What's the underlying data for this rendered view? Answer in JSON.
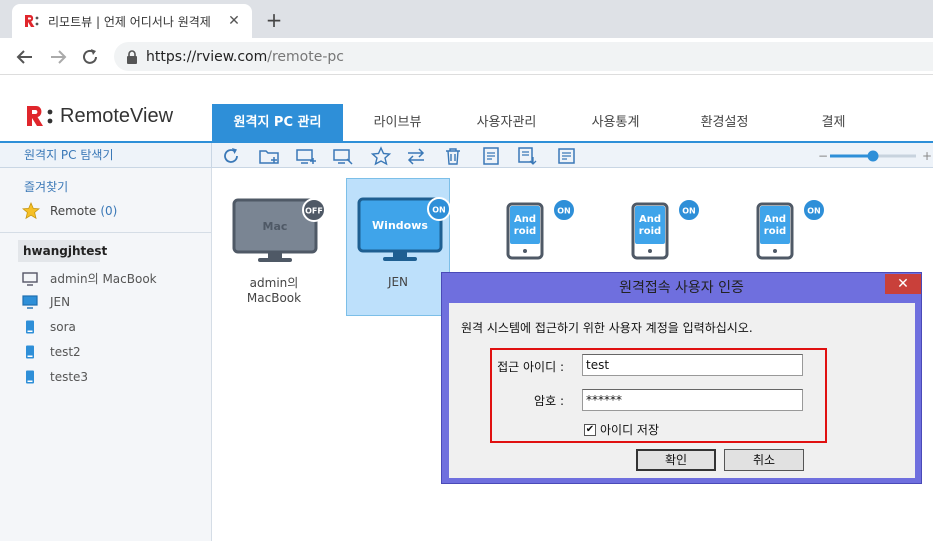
{
  "browser": {
    "tab_title": "리모트뷰 | 언제 어디서나 원격제",
    "tab_close": "✕",
    "new_tab": "+",
    "url_host": "https://rview.com",
    "url_path": "/remote-pc"
  },
  "app": {
    "brand": "RemoteView",
    "nav": [
      "원격지 PC 관리",
      "라이브뷰",
      "사용자관리",
      "사용통계",
      "환경설정",
      "결제"
    ],
    "explorer_title": "원격지 PC 탐색기",
    "zoom_minus": "−",
    "zoom_plus": "+",
    "zoom_level": 0.5
  },
  "sidebar": {
    "favorites_title": "즐겨찾기",
    "favorite_item": "Remote",
    "favorite_count": "(0)",
    "group": "hwangjhtest",
    "pcs": [
      {
        "label": "admin의 MacBook",
        "icon": "monitor-icon"
      },
      {
        "label": "JEN",
        "icon": "monitor-icon"
      },
      {
        "label": "sora",
        "icon": "tablet-icon"
      },
      {
        "label": "test2",
        "icon": "tablet-icon"
      },
      {
        "label": "teste3",
        "icon": "tablet-icon"
      }
    ]
  },
  "devices": [
    {
      "os": "Mac",
      "label1": "admin의",
      "label2": "MacBook",
      "status": "OFF"
    },
    {
      "os": "Windows",
      "label1": "JEN",
      "label2": "",
      "status": "ON"
    },
    {
      "os": "Android",
      "status": "ON"
    },
    {
      "os": "Android",
      "status": "ON"
    },
    {
      "os": "Android",
      "status": "ON"
    }
  ],
  "dialog": {
    "title": "원격접속 사용자 인증",
    "close": "✕",
    "message": "원격 시스템에 접근하기 위한 사용자 계정을 입력하십시오.",
    "id_label": "접근 아이디 :",
    "id_value": "test",
    "pw_label": "암호 :",
    "pw_value": "******",
    "save_id_label": "아이디 저장",
    "save_id_checked": "✔",
    "ok_label": "확인",
    "cancel_label": "취소"
  },
  "colors": {
    "accent": "#2e8fd8",
    "dialog_frame": "#6f6fde",
    "highlight": "#e01010",
    "android_blue": "#3fa4ea",
    "mac_gray": "#7a8593"
  }
}
